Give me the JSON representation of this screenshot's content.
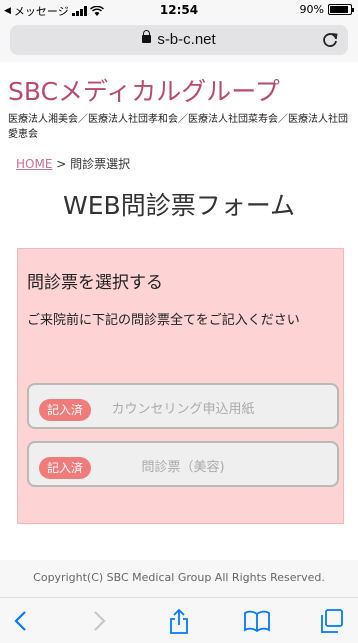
{
  "status_bar": {
    "carrier": "メッセージ",
    "time": "12:54",
    "battery_percent": "90%",
    "battery_level": 0.9
  },
  "browser": {
    "url": "s-b-c.net"
  },
  "header": {
    "site_title": "SBCメディカルグループ",
    "affiliates": "医療法人湘美会／医療法人社団孝和会／医療法人社団菜寿会／医療法人社団愛恵会"
  },
  "breadcrumb": {
    "home": "HOME",
    "separator": ">",
    "current": "問診票選択"
  },
  "page_title": "WEB問診票フォーム",
  "panel": {
    "title": "問診票を選択する",
    "description": "ご来院前に下記の問診票全てをご記入ください",
    "items": [
      {
        "badge": "記入済",
        "label": "カウンセリング申込用紙"
      },
      {
        "badge": "記入済",
        "label": "問診票（美容)"
      }
    ]
  },
  "footer": {
    "copyright": "Copyright(C) SBC Medical Group All Rights Reserved."
  },
  "toolbar": {
    "icons": [
      "back-icon",
      "forward-icon",
      "share-icon",
      "bookmarks-icon",
      "tabs-icon"
    ]
  },
  "colors": {
    "brand": "#b84a72",
    "panel_bg": "#fdd3d3",
    "badge": "#f07b7b",
    "ios_blue": "#007aff"
  }
}
